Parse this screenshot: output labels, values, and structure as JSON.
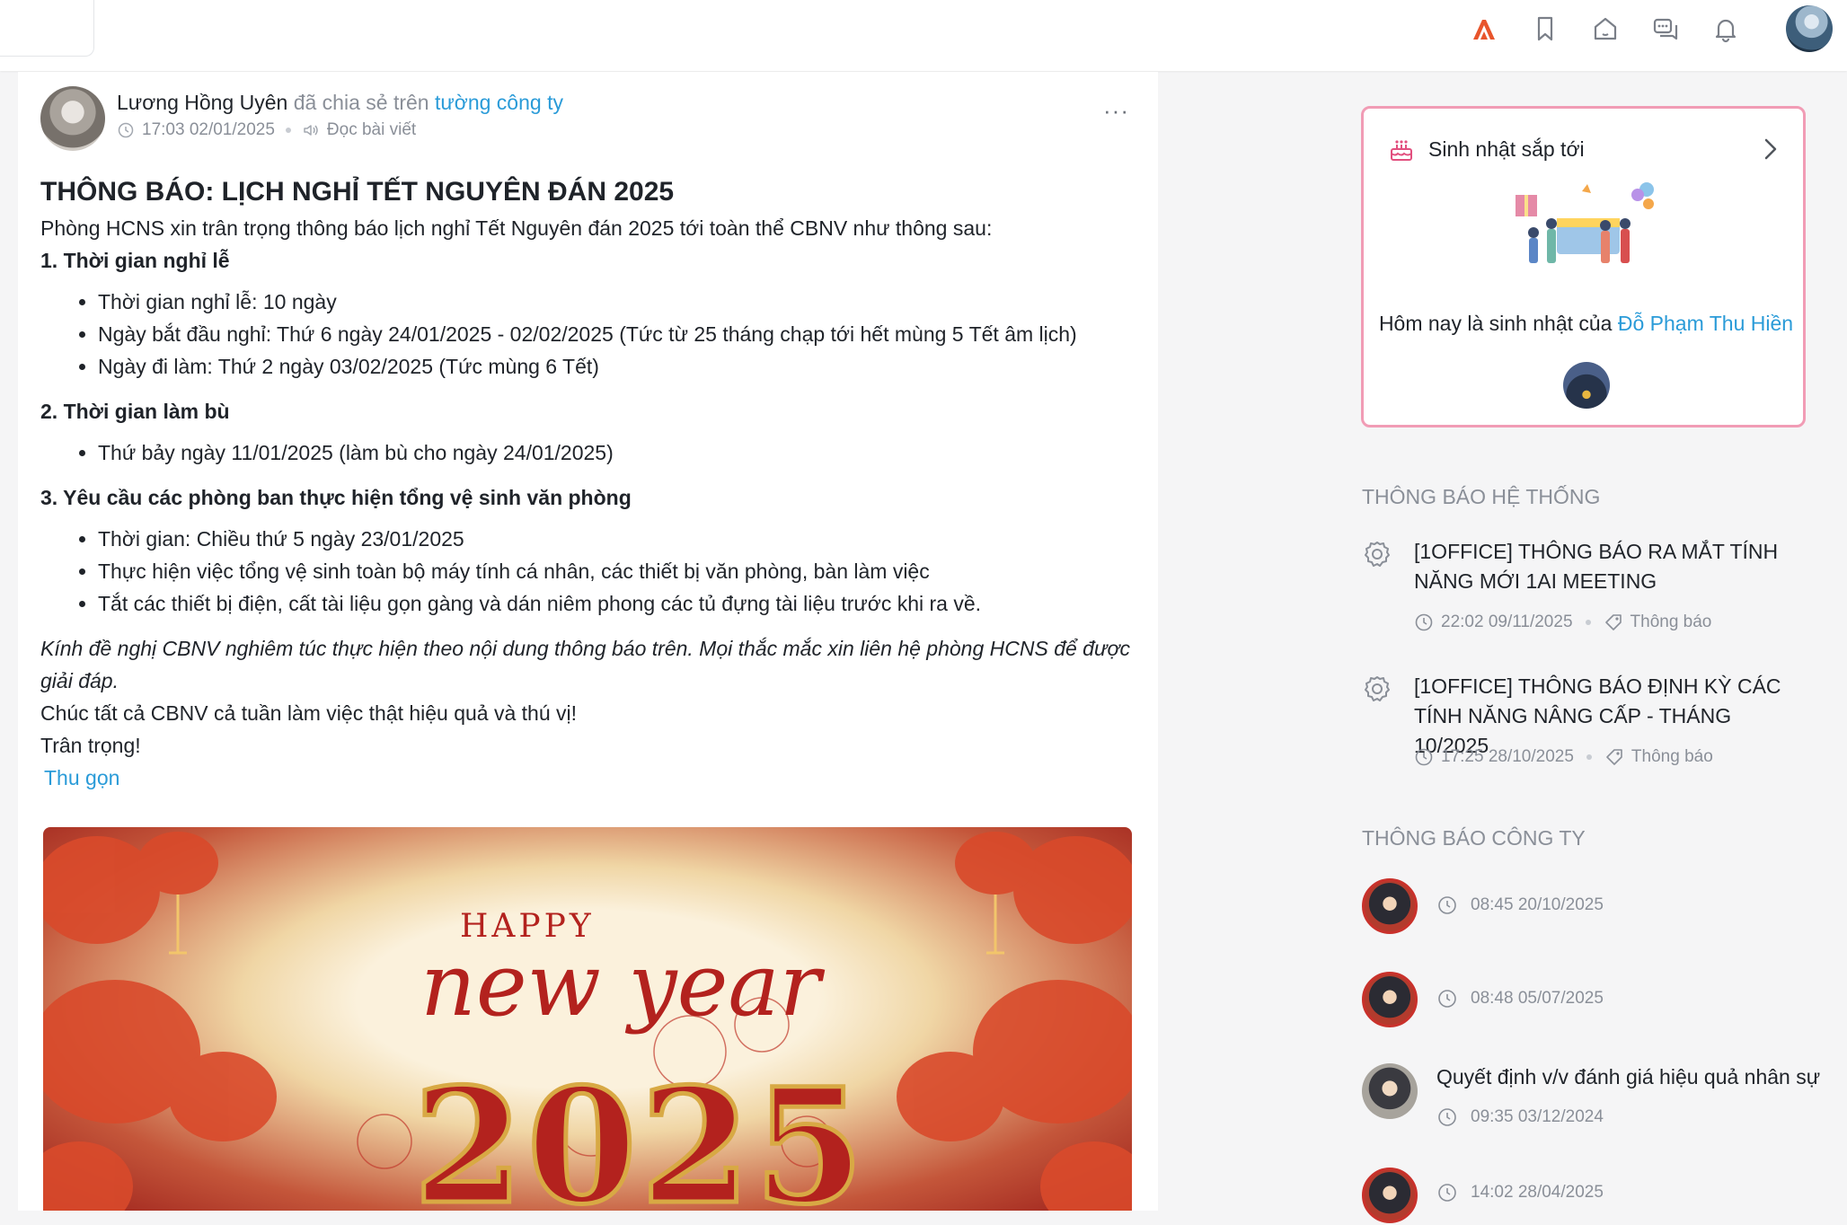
{
  "topbar": {
    "icons": [
      "brand-logo-icon",
      "bookmark-icon",
      "home-icon",
      "chat-icon",
      "bell-icon"
    ],
    "brand_color": "#e8552c"
  },
  "post": {
    "author": "Lương Hồng Uyên",
    "shared_text": "đã chia sẻ trên",
    "wall_link": "tường công ty",
    "time": "17:03 02/01/2025",
    "read_article": "Đọc bài viết",
    "more": "···",
    "heading": "THÔNG BÁO: LỊCH NGHỈ TẾT NGUYÊN ĐÁN 2025",
    "intro": "Phòng HCNS xin trân trọng thông báo lịch nghỉ Tết Nguyên đán 2025 tới toàn thể CBNV như thông sau:",
    "sections": [
      {
        "title": "1. Thời gian nghỉ lễ",
        "items": [
          "Thời gian nghỉ lễ: 10 ngày",
          "Ngày bắt đầu nghỉ: Thứ 6 ngày 24/01/2025 - 02/02/2025 (Tức từ 25 tháng chạp tới hết mùng 5 Tết âm lịch)",
          "Ngày đi làm: Thứ 2 ngày 03/02/2025 (Tức mùng 6 Tết)"
        ]
      },
      {
        "title": "2. Thời gian làm bù",
        "items": [
          "Thứ bảy ngày 11/01/2025 (làm bù cho ngày 24/01/2025)"
        ]
      },
      {
        "title": "3. Yêu cầu các phòng ban thực hiện tổng vệ sinh văn phòng",
        "items": [
          "Thời gian: Chiều thứ 5 ngày 23/01/2025",
          "Thực hiện việc tổng vệ sinh toàn bộ máy tính cá nhân, các thiết bị văn phòng, bàn làm việc",
          "Tắt các thiết bị điện, cất tài liệu gọn gàng và dán niêm phong các tủ đựng tài liệu trước khi ra về."
        ]
      }
    ],
    "closing_italic": "Kính đề nghị CBNV nghiêm túc thực hiện theo nội dung thông báo trên. Mọi thắc mắc xin liên hệ phòng HCNS để được giải đáp.",
    "closing_wish": "Chúc tất cả CBNV cả tuần làm việc thật hiệu quả và thú vị!",
    "regards": "Trân trọng!",
    "collapse": "Thu gọn",
    "banner": {
      "happy": "HAPPY",
      "new_year": "new year",
      "year": "2025"
    }
  },
  "birthday": {
    "title": "Sinh nhật sắp tới",
    "text_prefix": "Hôm nay là sinh nhật của",
    "person": "Đỗ Phạm Thu Hiền",
    "border_color": "#f19cb5"
  },
  "system_notices": {
    "title": "THÔNG BÁO HỆ THỐNG",
    "items": [
      {
        "title": "[1OFFICE] THÔNG BÁO RA MẮT TÍNH NĂNG MỚI 1AI MEETING",
        "time": "22:02 09/11/2025",
        "tag": "Thông báo"
      },
      {
        "title": "[1OFFICE] THÔNG BÁO ĐỊNH KỲ CÁC TÍNH NĂNG NÂNG CẤP - THÁNG 10/2025",
        "time": "17:25 28/10/2025",
        "tag": "Thông báo"
      }
    ]
  },
  "company_notices": {
    "title": "THÔNG BÁO CÔNG TY",
    "items": [
      {
        "title": "",
        "time": "08:45 20/10/2025"
      },
      {
        "title": "",
        "time": "08:48 05/07/2025"
      },
      {
        "title": "Quyết định v/v đánh giá hiệu quả nhân sự",
        "time": "09:35 03/12/2024"
      },
      {
        "title": "",
        "time": "14:02 28/04/2025"
      }
    ]
  },
  "colors": {
    "link": "#2a9bd8",
    "muted": "#8a8f98",
    "text": "#1f2329"
  }
}
